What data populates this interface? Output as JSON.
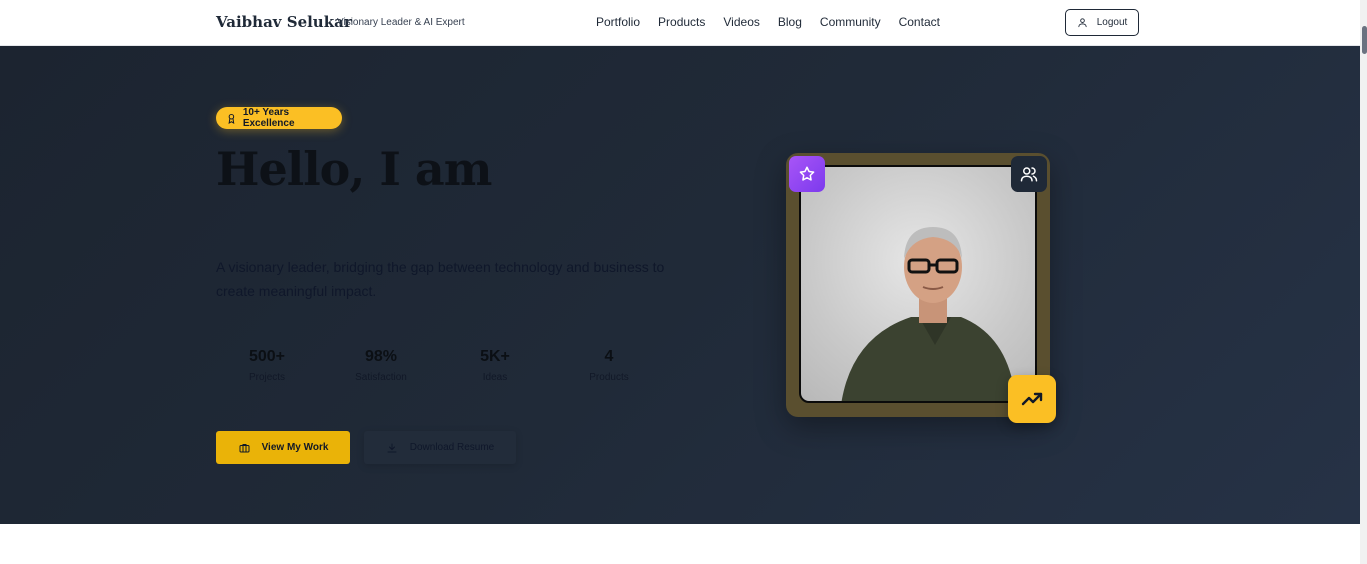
{
  "header": {
    "brand_name": "Vaibhav Selukar",
    "brand_tagline": "Visionary Leader & AI Expert",
    "nav": [
      "Portfolio",
      "Products",
      "Videos",
      "Blog",
      "Community",
      "Contact"
    ],
    "logout_label": "Logout"
  },
  "hero": {
    "badge": "10+ Years Excellence",
    "title": "Hello, I am",
    "description": "A visionary leader, bridging the gap between technology and business to create meaningful impact.",
    "stats": [
      {
        "value": "500+",
        "label": "Projects"
      },
      {
        "value": "98%",
        "label": "Satisfaction"
      },
      {
        "value": "5K+",
        "label": "Ideas"
      },
      {
        "value": "4",
        "label": "Products"
      }
    ],
    "primary_button": "View My Work",
    "secondary_button": "Download Resume"
  },
  "colors": {
    "accent": "#eab308",
    "badge": "#fbbf24",
    "hero_bg": "#1f2937",
    "star_badge": "#8b5cf6"
  },
  "icons": {
    "badge": "award-icon",
    "logout": "user-icon",
    "primary_button": "briefcase-icon",
    "secondary_button": "download-icon",
    "photo_top_left": "star-icon",
    "photo_top_right": "users-icon",
    "photo_bottom_right": "trending-up-icon"
  }
}
